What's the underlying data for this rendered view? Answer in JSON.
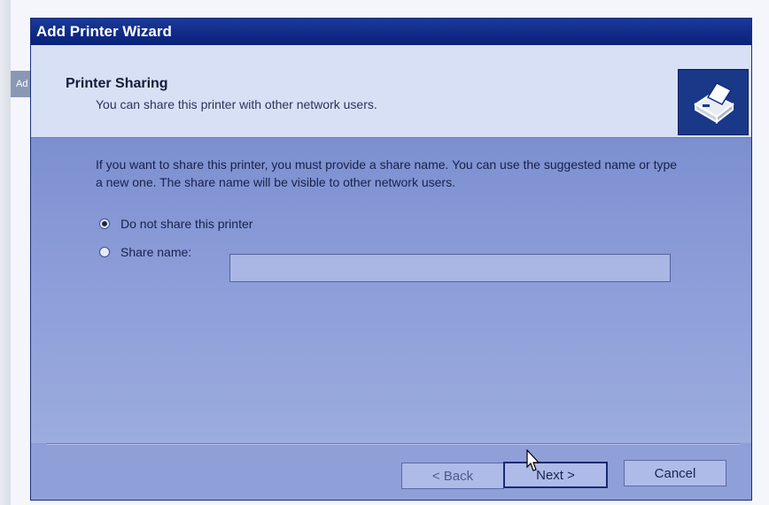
{
  "desktop": {
    "stub_text": "Ad"
  },
  "window": {
    "title": "Add Printer Wizard"
  },
  "header": {
    "title": "Printer Sharing",
    "subtitle": "You can share this printer with other network users.",
    "icon": "printer-icon"
  },
  "content": {
    "description": "If you want to share this printer, you must provide a share name. You can use the suggested name or type a new one. The share name will be visible to other network users.",
    "options": [
      {
        "label": "Do not share this printer",
        "selected": true
      },
      {
        "label": "Share name:",
        "selected": false
      }
    ],
    "share_name_value": ""
  },
  "footer": {
    "back_label": "< Back",
    "next_label": "Next >",
    "cancel_label": "Cancel"
  }
}
